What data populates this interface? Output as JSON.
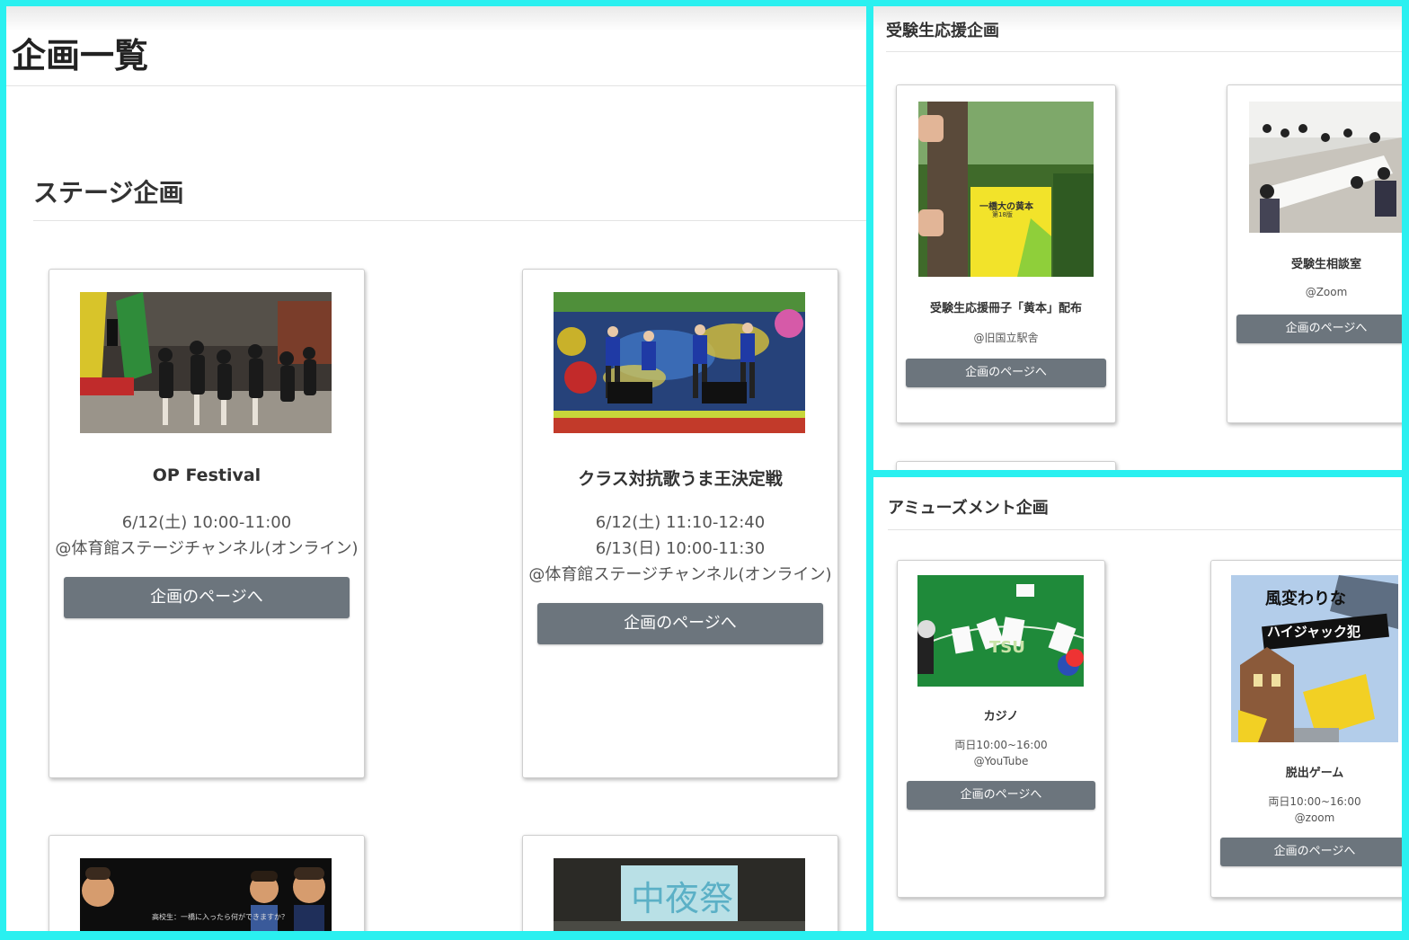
{
  "page": {
    "title": "企画一覧"
  },
  "stage": {
    "heading": "ステージ企画",
    "cards": [
      {
        "title": "OP Festival",
        "lines": [
          "6/12(土) 10:00-11:00",
          "@体育館ステージチャンネル(オンライン)"
        ],
        "button": "企画のページへ"
      },
      {
        "title": "クラス対抗歌うま王決定戦",
        "lines": [
          "6/12(土) 11:10-12:40",
          "6/13(日) 10:00-11:30",
          "@体育館ステージチャンネル(オンライン)"
        ],
        "button": "企画のページへ"
      },
      {
        "image_text": "高校生：一橋に入ったら何ができますか？"
      },
      {
        "image_text": "中夜祭"
      }
    ]
  },
  "examinee": {
    "heading": "受験生応援企画",
    "cards": [
      {
        "title": "受験生応援冊子「黄本」配布",
        "lines": [
          "@旧国立駅舎"
        ],
        "button": "企画のページへ",
        "book_text": [
          "一橋大の黄本",
          "第18版"
        ]
      },
      {
        "title": "受験生相談室",
        "lines": [
          "@Zoom"
        ],
        "button": "企画のページへ"
      }
    ]
  },
  "amusement": {
    "heading": "アミューズメント企画",
    "cards": [
      {
        "title": "カジノ",
        "lines": [
          "両日10:00~16:00",
          "@YouTube"
        ],
        "button": "企画のページへ",
        "table_text": "TSU"
      },
      {
        "title": "脱出ゲーム",
        "lines": [
          "両日10:00~16:00",
          "@zoom"
        ],
        "button": "企画のページへ",
        "poster_text": [
          "風変わりな",
          "ハイジャック犯"
        ]
      }
    ]
  },
  "colors": {
    "frame": "#2af0f0",
    "button": "#6c757d",
    "rule": "#e3e3e3"
  }
}
